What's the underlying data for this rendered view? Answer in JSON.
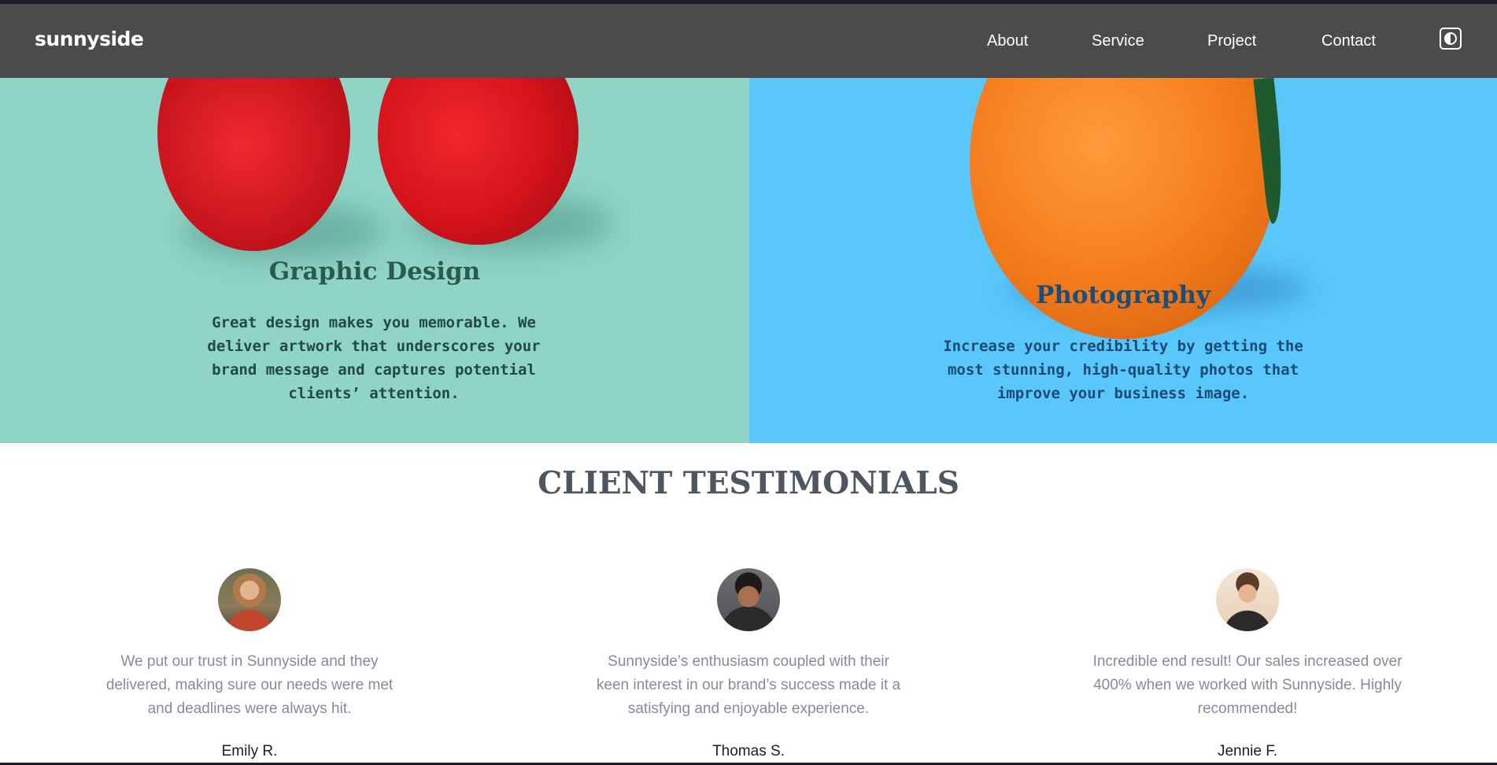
{
  "brand": {
    "logo": "sunnyside"
  },
  "nav": {
    "links": [
      {
        "label": "About"
      },
      {
        "label": "Service"
      },
      {
        "label": "Project"
      },
      {
        "label": "Contact"
      }
    ],
    "theme_toggle_icon": "contrast-icon"
  },
  "services": [
    {
      "title": "Graphic Design",
      "text": "Great design makes you memorable. We deliver artwork that underscores your brand message and captures potential clients’ attention.",
      "background": "#90d4c5",
      "image_icon": "cherries-image"
    },
    {
      "title": "Photography",
      "text": "Increase your credibility by getting the most stunning, high-quality photos that improve your business image.",
      "background": "#5ac7fb",
      "image_icon": "orange-image"
    }
  ],
  "testimonials": {
    "heading": "CLIENT TESTIMONIALS",
    "items": [
      {
        "quote": "We put our trust in Sunnyside and they delivered, making sure our needs were met and deadlines were always hit.",
        "name": "Emily R."
      },
      {
        "quote": "Sunnyside’s enthusiasm coupled with their keen interest in our brand’s success made it a satisfying and enjoyable experience.",
        "name": "Thomas S."
      },
      {
        "quote": "Incredible end result! Our sales increased over 400% when we worked with Sunnyside. Highly recommended!",
        "name": "Jennie F."
      }
    ]
  },
  "colors": {
    "navbar": "#4b4b4b",
    "heading": "#4d5661",
    "quote_text": "#868a9e"
  }
}
